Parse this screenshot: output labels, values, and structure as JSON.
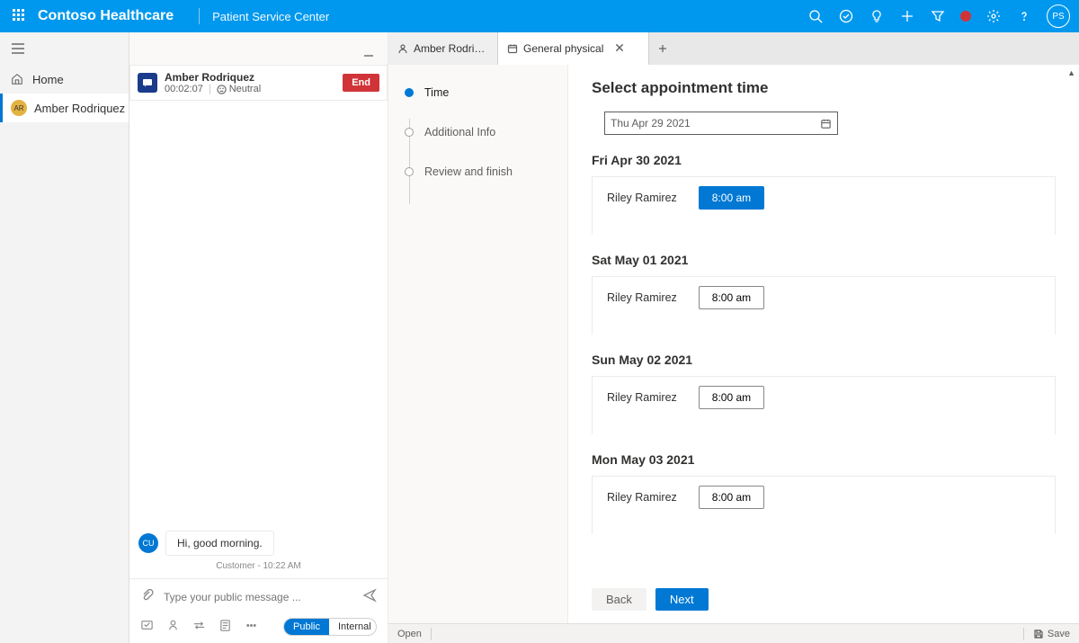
{
  "topbar": {
    "brand": "Contoso Healthcare",
    "app": "Patient Service Center",
    "avatar_initials": "PS"
  },
  "nav": {
    "home": "Home",
    "session": {
      "initials": "AR",
      "name": "Amber Rodriquez"
    }
  },
  "conversation": {
    "name": "Amber Rodriquez",
    "duration": "00:02:07",
    "sentiment": "Neutral",
    "end_label": "End",
    "message": {
      "avatar": "CU",
      "text": "Hi, good morning."
    },
    "message_meta": "Customer - 10:22 AM",
    "compose_placeholder": "Type your public message ...",
    "pill": {
      "public": "Public",
      "internal": "Internal"
    }
  },
  "tabs": {
    "profile": "Amber Rodriquez",
    "task": "General physical"
  },
  "steps": {
    "time": "Time",
    "additional": "Additional Info",
    "review": "Review and finish"
  },
  "appointment": {
    "title": "Select appointment time",
    "date_value": "Thu Apr 29 2021",
    "days": [
      {
        "label": "Fri Apr 30 2021",
        "provider": "Riley Ramirez",
        "slot": "8:00 am",
        "selected": true
      },
      {
        "label": "Sat May 01 2021",
        "provider": "Riley Ramirez",
        "slot": "8:00 am",
        "selected": false
      },
      {
        "label": "Sun May 02 2021",
        "provider": "Riley Ramirez",
        "slot": "8:00 am",
        "selected": false
      },
      {
        "label": "Mon May 03 2021",
        "provider": "Riley Ramirez",
        "slot": "8:00 am",
        "selected": false
      }
    ],
    "back": "Back",
    "next": "Next"
  },
  "statusbar": {
    "open": "Open",
    "save": "Save"
  }
}
